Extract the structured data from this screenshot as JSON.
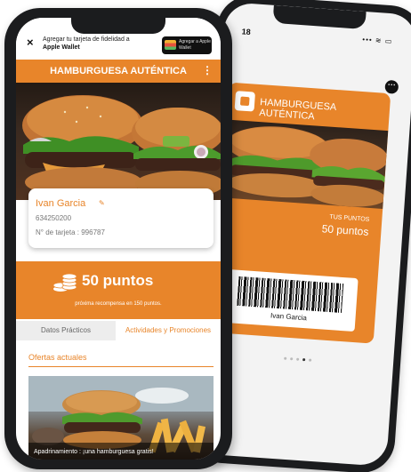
{
  "back_phone": {
    "status_time": "18",
    "status_icons": "••• ≋ ▭",
    "more_icon": "ellipsis-icon",
    "pass": {
      "title": "HAMBURGUESA AUTÉNTICA",
      "points_label": "TUS PUNTOS",
      "points_value": "50 puntos",
      "barcode_name": "Ivan Garcia"
    }
  },
  "wallet_banner": {
    "close_icon": "close-icon",
    "line1": "Agregar tu tarjeta de fidelidad a",
    "line2": "Apple Wallet",
    "button_label": "Agregar a Apple Wallet"
  },
  "header": {
    "title": "HAMBURGUESA AUTÉNTICA",
    "menu_icon": "kebab-icon"
  },
  "profile": {
    "name": "Ivan Garcia",
    "edit_icon": "pencil-icon",
    "phone": "634250200",
    "card_number": "N° de tarjeta : 996787"
  },
  "points": {
    "icon": "coins-icon",
    "value": "50 puntos",
    "reward": "próxima recompensa en 150 puntos."
  },
  "tabs": [
    {
      "label": "Datos Prácticos",
      "active": false
    },
    {
      "label": "Actividades y Promociones",
      "active": true
    }
  ],
  "offers": {
    "section_title": "Ofertas actuales",
    "items": [
      {
        "caption": "Apadrinamiento : ¡una hamburguesa gratis!"
      }
    ]
  },
  "colors": {
    "accent": "#e8852a",
    "phone_frame": "#1b1c1e"
  }
}
